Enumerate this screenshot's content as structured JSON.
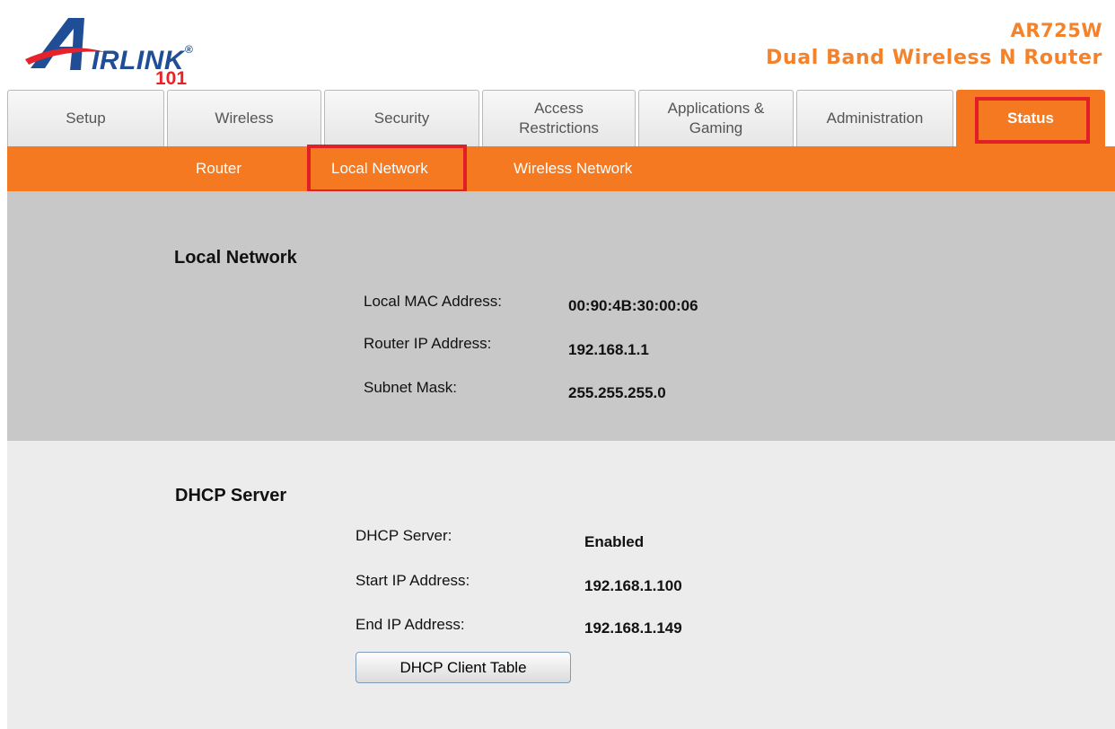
{
  "brand": {
    "logo_text": "IRLINK",
    "logo_reg": "®",
    "logo_number": "101",
    "model": "AR725W",
    "description": "Dual Band Wireless N Router"
  },
  "tabs": [
    {
      "line1": "Setup",
      "line2": ""
    },
    {
      "line1": "Wireless",
      "line2": ""
    },
    {
      "line1": "Security",
      "line2": ""
    },
    {
      "line1": "Access",
      "line2": "Restrictions"
    },
    {
      "line1": "Applications &",
      "line2": "Gaming"
    },
    {
      "line1": "Administration",
      "line2": ""
    },
    {
      "line1": "Status",
      "line2": ""
    }
  ],
  "subnav": {
    "router": "Router",
    "local_network": "Local Network",
    "wireless_network": "Wireless Network"
  },
  "local_network": {
    "title": "Local Network",
    "mac_label": "Local MAC Address:",
    "mac_value": "00:90:4B:30:00:06",
    "ip_label": "Router IP Address:",
    "ip_value": "192.168.1.1",
    "mask_label": "Subnet Mask:",
    "mask_value": "255.255.255.0"
  },
  "dhcp": {
    "title": "DHCP Server",
    "server_label": "DHCP Server:",
    "server_value": "Enabled",
    "start_label": "Start IP Address:",
    "start_value": "192.168.1.100",
    "end_label": "End IP Address:",
    "end_value": "192.168.1.149",
    "client_table_button": "DHCP Client Table"
  },
  "colors": {
    "accent": "#f47920",
    "highlight": "#e01f26",
    "logo_blue": "#1f4e97",
    "logo_red": "#e6232b"
  }
}
